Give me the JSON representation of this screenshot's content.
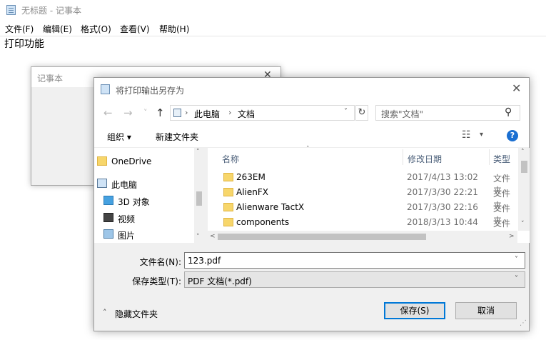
{
  "notepad": {
    "title": "无标题 - 记事本",
    "menu": [
      "文件(F)",
      "编辑(E)",
      "格式(O)",
      "查看(V)",
      "帮助(H)"
    ],
    "content": "打印功能"
  },
  "background_dialog": {
    "title": "记事本",
    "close_glyph": "✕"
  },
  "save_dialog": {
    "title": "将打印输出另存为",
    "close_glyph": "✕",
    "nav": {
      "back": "←",
      "forward": "→",
      "recent": "˅",
      "up": "↑"
    },
    "address": {
      "segments": [
        "此电脑",
        "文档"
      ],
      "separator": "›",
      "dropdown": "˅",
      "refresh": "↻"
    },
    "search": {
      "placeholder": "搜索\"文档\"",
      "icon": "⚲"
    },
    "toolbar": {
      "organize": "组织 ▾",
      "new_folder": "新建文件夹",
      "view_icon": "☷",
      "view_dropdown": "▾",
      "help": "?"
    },
    "nav_pane": [
      {
        "label": "OneDrive",
        "icon": "folder-icon"
      },
      {
        "label": "此电脑",
        "icon": "computer-icon"
      },
      {
        "label": "3D 对象",
        "icon": "cube-icon"
      },
      {
        "label": "视频",
        "icon": "video-icon"
      },
      {
        "label": "图片",
        "icon": "picture-icon"
      }
    ],
    "columns": {
      "name": "名称",
      "date": "修改日期",
      "type": "类型",
      "sort_glyph": "˄"
    },
    "files": [
      {
        "name": "263EM",
        "date": "2017/4/13 13:02",
        "type": "文件夹"
      },
      {
        "name": "AlienFX",
        "date": "2017/3/30 22:21",
        "type": "文件夹"
      },
      {
        "name": "Alienware TactX",
        "date": "2017/3/30 22:16",
        "type": "文件夹"
      },
      {
        "name": "components",
        "date": "2018/3/13 10:44",
        "type": "文件夹"
      }
    ],
    "scroll_glyphs": {
      "up": "˄",
      "down": "˅",
      "left": "<",
      "right": ">"
    },
    "filename_label": "文件名(N):",
    "filename_value": "123.pdf",
    "filetype_label": "保存类型(T):",
    "filetype_value": "PDF 文档(*.pdf)",
    "field_dropdown": "˅",
    "hide_folders": "隐藏文件夹",
    "hide_chevron": "˄",
    "save_button": "保存(S)",
    "cancel_button": "取消",
    "grip": "⋰"
  }
}
